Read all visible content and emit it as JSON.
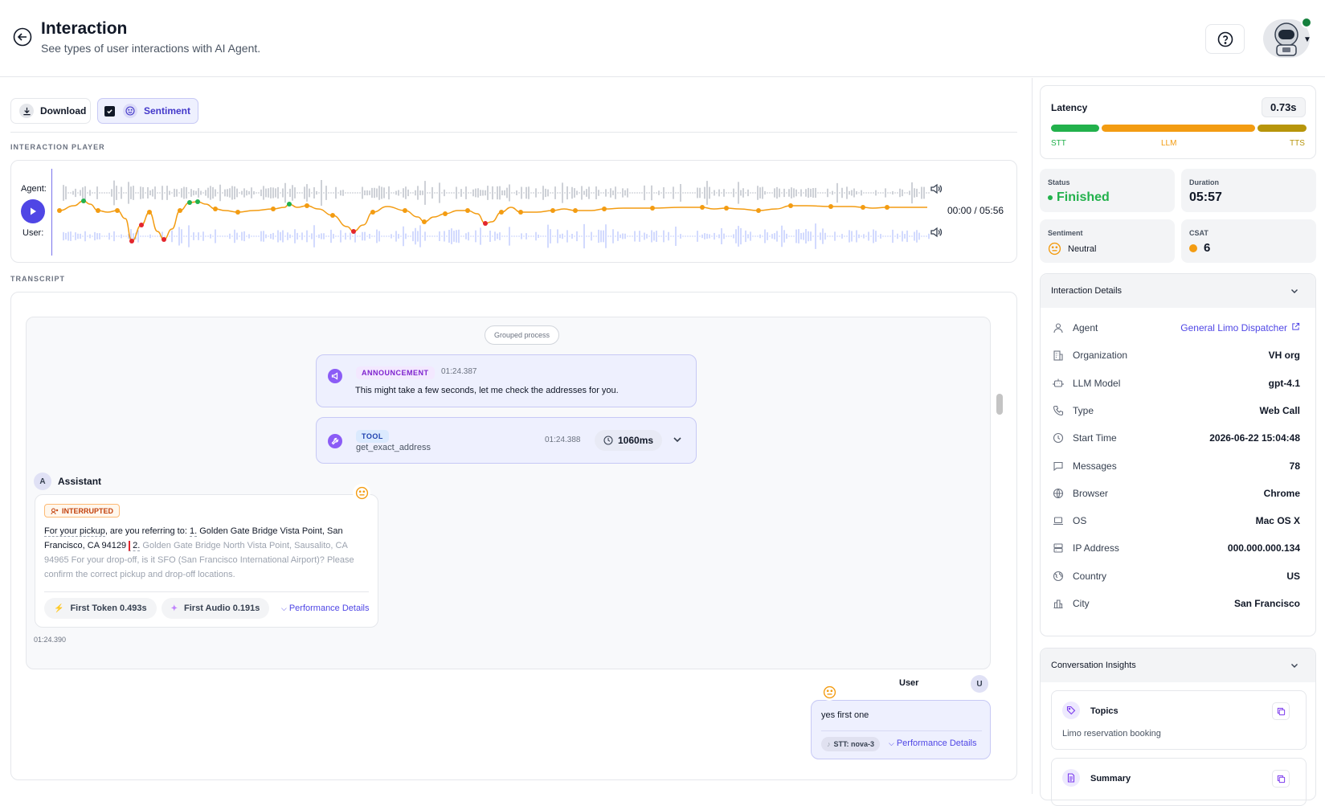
{
  "header": {
    "title": "Interaction",
    "subtitle": "See types of user interactions with AI Agent."
  },
  "toolbar": {
    "download_label": "Download",
    "sentiment_label": "Sentiment",
    "sentiment_checked": true
  },
  "player": {
    "section_label": "INTERACTION PLAYER",
    "agent_label": "Agent:",
    "user_label": "User:",
    "time": "00:00 / 05:56",
    "playhead_fraction": 0
  },
  "transcript": {
    "section_label": "TRANSCRIPT",
    "grouped_label": "Grouped process",
    "announcement": {
      "tag": "ANNOUNCEMENT",
      "time": "01:24.387",
      "text": "This might take a few seconds, let me check the addresses for you."
    },
    "tool": {
      "tag": "TOOL",
      "name": "get_exact_address",
      "time": "01:24.388",
      "duration": "1060ms"
    },
    "assistant": {
      "avatar": "A",
      "name": "Assistant",
      "badge": "INTERRUPTED",
      "text_spoken_1": "For your pickup",
      "text_spoken_2": ", are you referring to: ",
      "text_spoken_3": "1.",
      "text_spoken_4": " Golden Gate Bridge Vista Point, San Francisco, CA 94129 ",
      "text_spoken_5": "2.",
      "text_unspoken": " Golden Gate Bridge North Vista Point, Sausalito, CA 94965 For your drop-off, is it SFO (San Francisco International Airport)? Please confirm the correct pickup and drop-off locations.",
      "first_token": "First Token 0.493s",
      "first_audio": "First Audio 0.191s",
      "perf_link": "Performance Details",
      "timestamp": "01:24.390"
    },
    "user": {
      "avatar": "U",
      "name": "User",
      "text": "yes first one",
      "stt": "STT: nova-3",
      "perf_link": "Performance Details"
    }
  },
  "latency": {
    "label": "Latency",
    "value": "0.73s",
    "segments": [
      {
        "name": "STT",
        "fraction": 0.25,
        "color": "#22b14c"
      },
      {
        "name": "LLM",
        "fraction": 0.082,
        "color": "#f39c12"
      },
      {
        "name": "TTS",
        "fraction": 0.052,
        "color": "#b7950b"
      }
    ]
  },
  "stats": {
    "status_label": "Status",
    "status_value": "Finished",
    "duration_label": "Duration",
    "duration_value": "05:57",
    "sentiment_label": "Sentiment",
    "sentiment_value": "Neutral",
    "csat_label": "CSAT",
    "csat_value": "6"
  },
  "details": {
    "title": "Interaction Details",
    "rows": [
      {
        "icon": "person-icon",
        "key": "Agent",
        "value": "General Limo Dispatcher",
        "link": true
      },
      {
        "icon": "building-icon",
        "key": "Organization",
        "value": "VH org"
      },
      {
        "icon": "robot-icon",
        "key": "LLM Model",
        "value": "gpt-4.1"
      },
      {
        "icon": "phone-icon",
        "key": "Type",
        "value": "Web Call"
      },
      {
        "icon": "clock-icon",
        "key": "Start Time",
        "value": "2026-06-22 15:04:48"
      },
      {
        "icon": "message-icon",
        "key": "Messages",
        "value": "78"
      },
      {
        "icon": "globe-icon",
        "key": "Browser",
        "value": "Chrome"
      },
      {
        "icon": "laptop-icon",
        "key": "OS",
        "value": "Mac OS X"
      },
      {
        "icon": "server-icon",
        "key": "IP Address",
        "value": "000.000.000.134"
      },
      {
        "icon": "earth-icon",
        "key": "Country",
        "value": "US"
      },
      {
        "icon": "city-icon",
        "key": "City",
        "value": "San Francisco"
      }
    ]
  },
  "insights": {
    "title": "Conversation Insights",
    "topics_title": "Topics",
    "topics_value": "Limo reservation booking",
    "summary_title": "Summary"
  },
  "colors": {
    "accent": "#4f46e5",
    "positive": "#22b14c",
    "neutral": "#f39c12",
    "negative": "#e3262d",
    "wave": "#9ca3af",
    "wave_user": "#a5b4fc"
  }
}
